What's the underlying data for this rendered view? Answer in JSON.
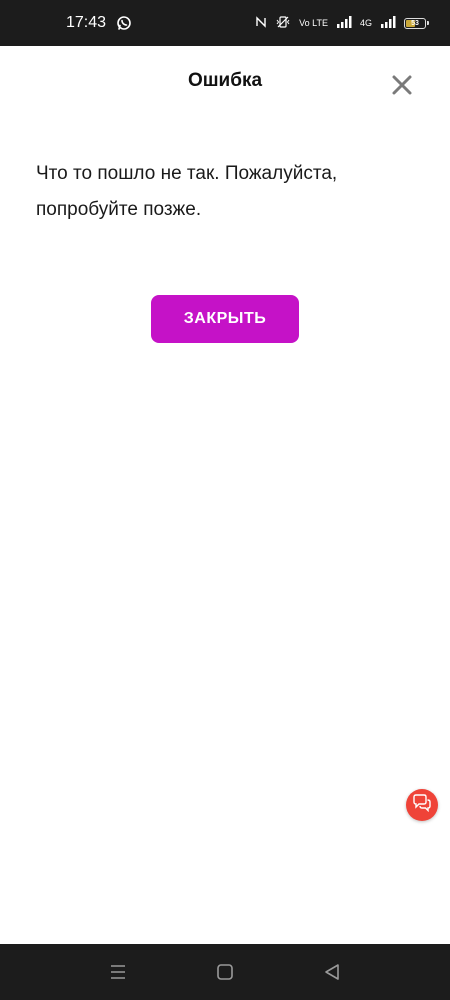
{
  "status_bar": {
    "time": "17:43",
    "network_label": "Vo LTE",
    "network_type": "4G",
    "battery_level": "53",
    "battery_percent": 53,
    "icons": [
      "whatsapp-icon",
      "nfc-icon",
      "vibrate-icon",
      "signal-icon",
      "signal-icon",
      "battery-icon"
    ]
  },
  "dialog": {
    "title": "Ошибка",
    "message": "Что то пошло не так. Пожалуйста, попробуйте позже.",
    "close_button_label": "ЗАКРЫТЬ"
  },
  "colors": {
    "accent": "#c512c7",
    "fab": "#ef4338",
    "system_bar": "#1c1c1c"
  },
  "nav_bar": {
    "icons": [
      "menu-icon",
      "home-icon",
      "back-icon"
    ]
  }
}
